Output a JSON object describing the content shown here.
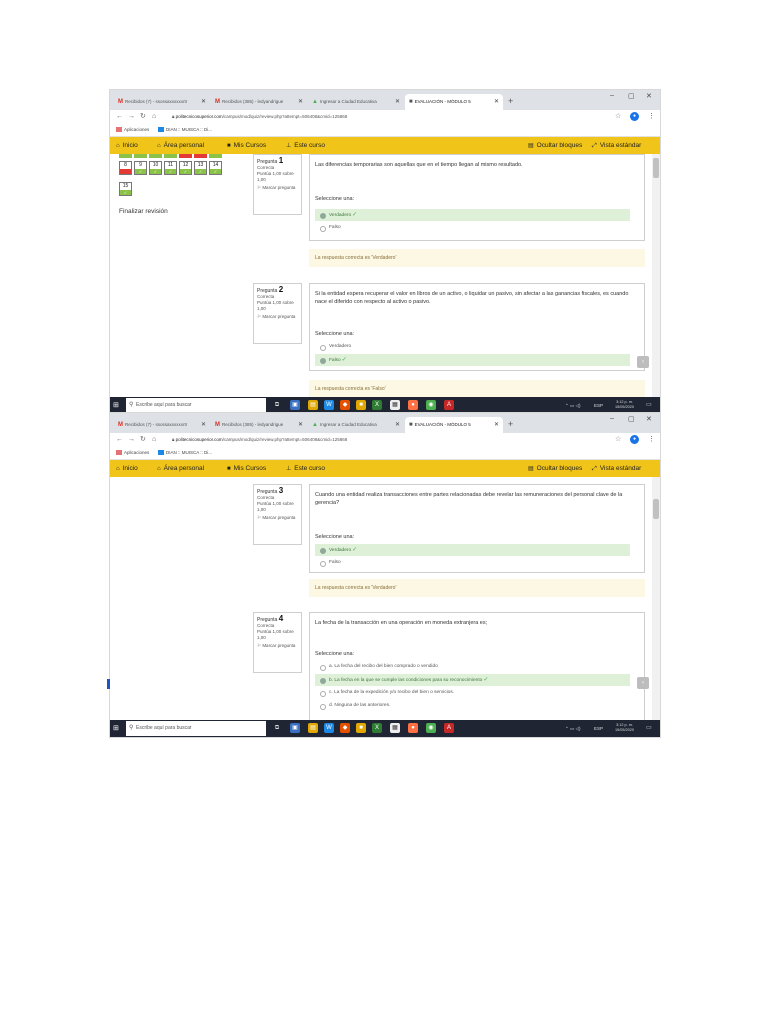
{
  "shots": [
    {
      "browser": {
        "tabs": [
          {
            "label": "Recibidos (7) - ssossaxxxxxxrtr"
          },
          {
            "label": "Recibidos (385) - ledyandrigue"
          },
          {
            "label": "Ingresar a Ciudad Educativa"
          },
          {
            "label": "EVALUACIÓN - MÓDULO 5"
          }
        ],
        "url_host": "politecnicosuperior.com",
        "url_path": "/campus/mod/quiz/review.php?attempt=506408&cmid=125868",
        "bookmarks": [
          "Aplicaciones",
          "DIAN :: MUISCA :: Di..."
        ]
      },
      "nav": {
        "inicio": "Inicio",
        "area_personal": "Área personal",
        "mis_cursos": "Mis Cursos",
        "este_curso": "Este curso",
        "ocultar": "Ocultar bloques",
        "vista": "Vista estándar"
      },
      "quiz_nav": {
        "buttons": [
          "8",
          "9",
          "10",
          "11",
          "12",
          "13",
          "14",
          "15"
        ],
        "finalizar": "Finalizar revisión"
      },
      "questions": [
        {
          "label": "Pregunta",
          "number": "1",
          "state": "Correcta",
          "score": "Puntúa 1,00 sobre 1,00",
          "flag": "Marcar pregunta",
          "text": "Las diferencias temporarias son aquellas que en el tiempo llegan al mismo resultado.",
          "prompt": "Seleccione una:",
          "options": [
            {
              "label": "Verdadero",
              "selected": true
            },
            {
              "label": "Falso",
              "selected": false
            }
          ],
          "feedback": "La respuesta correcta es 'Verdadero'"
        },
        {
          "label": "Pregunta",
          "number": "2",
          "state": "Correcta",
          "score": "Puntúa 1,00 sobre 1,00",
          "flag": "Marcar pregunta",
          "text": "Si la entidad espera recuperar el valor en libros de un activo, o liquidar un pasivo, sin afectar a las ganancias fiscales, es cuando nace el diferido con respecto al activo o pasivo.",
          "prompt": "Seleccione una:",
          "options": [
            {
              "label": "Verdadero",
              "selected": false
            },
            {
              "label": "Falso",
              "selected": true
            }
          ],
          "feedback": "La respuesta correcta es 'Falso'"
        }
      ],
      "taskbar": {
        "search_placeholder": "Escribe aquí para buscar",
        "lang": "ESP",
        "time": "3:12 p. m.",
        "date": "15/05/2020"
      }
    },
    {
      "browser": {
        "tabs": [
          {
            "label": "Recibidos (7) - ssossaxxxxxxrtr"
          },
          {
            "label": "Recibidos (385) - ledyandrigue"
          },
          {
            "label": "Ingresar a Ciudad Educativa"
          },
          {
            "label": "EVALUACIÓN - MÓDULO 5"
          }
        ],
        "url_host": "politecnicosuperior.com",
        "url_path": "/campus/mod/quiz/review.php?attempt=506408&cmid=125868",
        "bookmarks": [
          "Aplicaciones",
          "DIAN :: MUISCA :: Di..."
        ]
      },
      "nav": {
        "inicio": "Inicio",
        "area_personal": "Área personal",
        "mis_cursos": "Mis Cursos",
        "este_curso": "Este curso",
        "ocultar": "Ocultar bloques",
        "vista": "Vista estándar"
      },
      "questions": [
        {
          "label": "Pregunta",
          "number": "3",
          "state": "Correcta",
          "score": "Puntúa 1,00 sobre 1,00",
          "flag": "Marcar pregunta",
          "text": "Cuando una entidad realiza transacciones entre partes relacionadas debe revelar las remuneraciones del personal clave de la gerencia?",
          "prompt": "Seleccione una:",
          "options": [
            {
              "label": "Verdadero",
              "selected": true
            },
            {
              "label": "Falso",
              "selected": false
            }
          ],
          "feedback": "La respuesta correcta es 'Verdadero'"
        },
        {
          "label": "Pregunta",
          "number": "4",
          "state": "Correcta",
          "score": "Puntúa 1,00 sobre 1,00",
          "flag": "Marcar pregunta",
          "text": "La fecha de la transacción en una operación en moneda extranjera es;",
          "prompt": "Seleccione una:",
          "options": [
            {
              "label": "a. La fecha del recibo del bien comprado o vendido",
              "selected": false
            },
            {
              "label": "b. La fecha en la que se cumple las condiciones para su reconocimiento",
              "selected": true
            },
            {
              "label": "c. La fecha de la expedición y/o recibo del bien o servicios.",
              "selected": false
            },
            {
              "label": "d. Ninguna de las anteriores.",
              "selected": false
            }
          ]
        }
      ],
      "taskbar": {
        "search_placeholder": "Escribe aquí para buscar",
        "lang": "ESP",
        "time": "3:12 p. m.",
        "date": "15/05/2020"
      }
    }
  ],
  "colors": {
    "moodle_yellow": "#f0c419",
    "correct_green": "#8bc34a",
    "wrong_red": "#e53935",
    "feedback_bg": "#fcf8e3",
    "taskbar": "#1f2533"
  }
}
